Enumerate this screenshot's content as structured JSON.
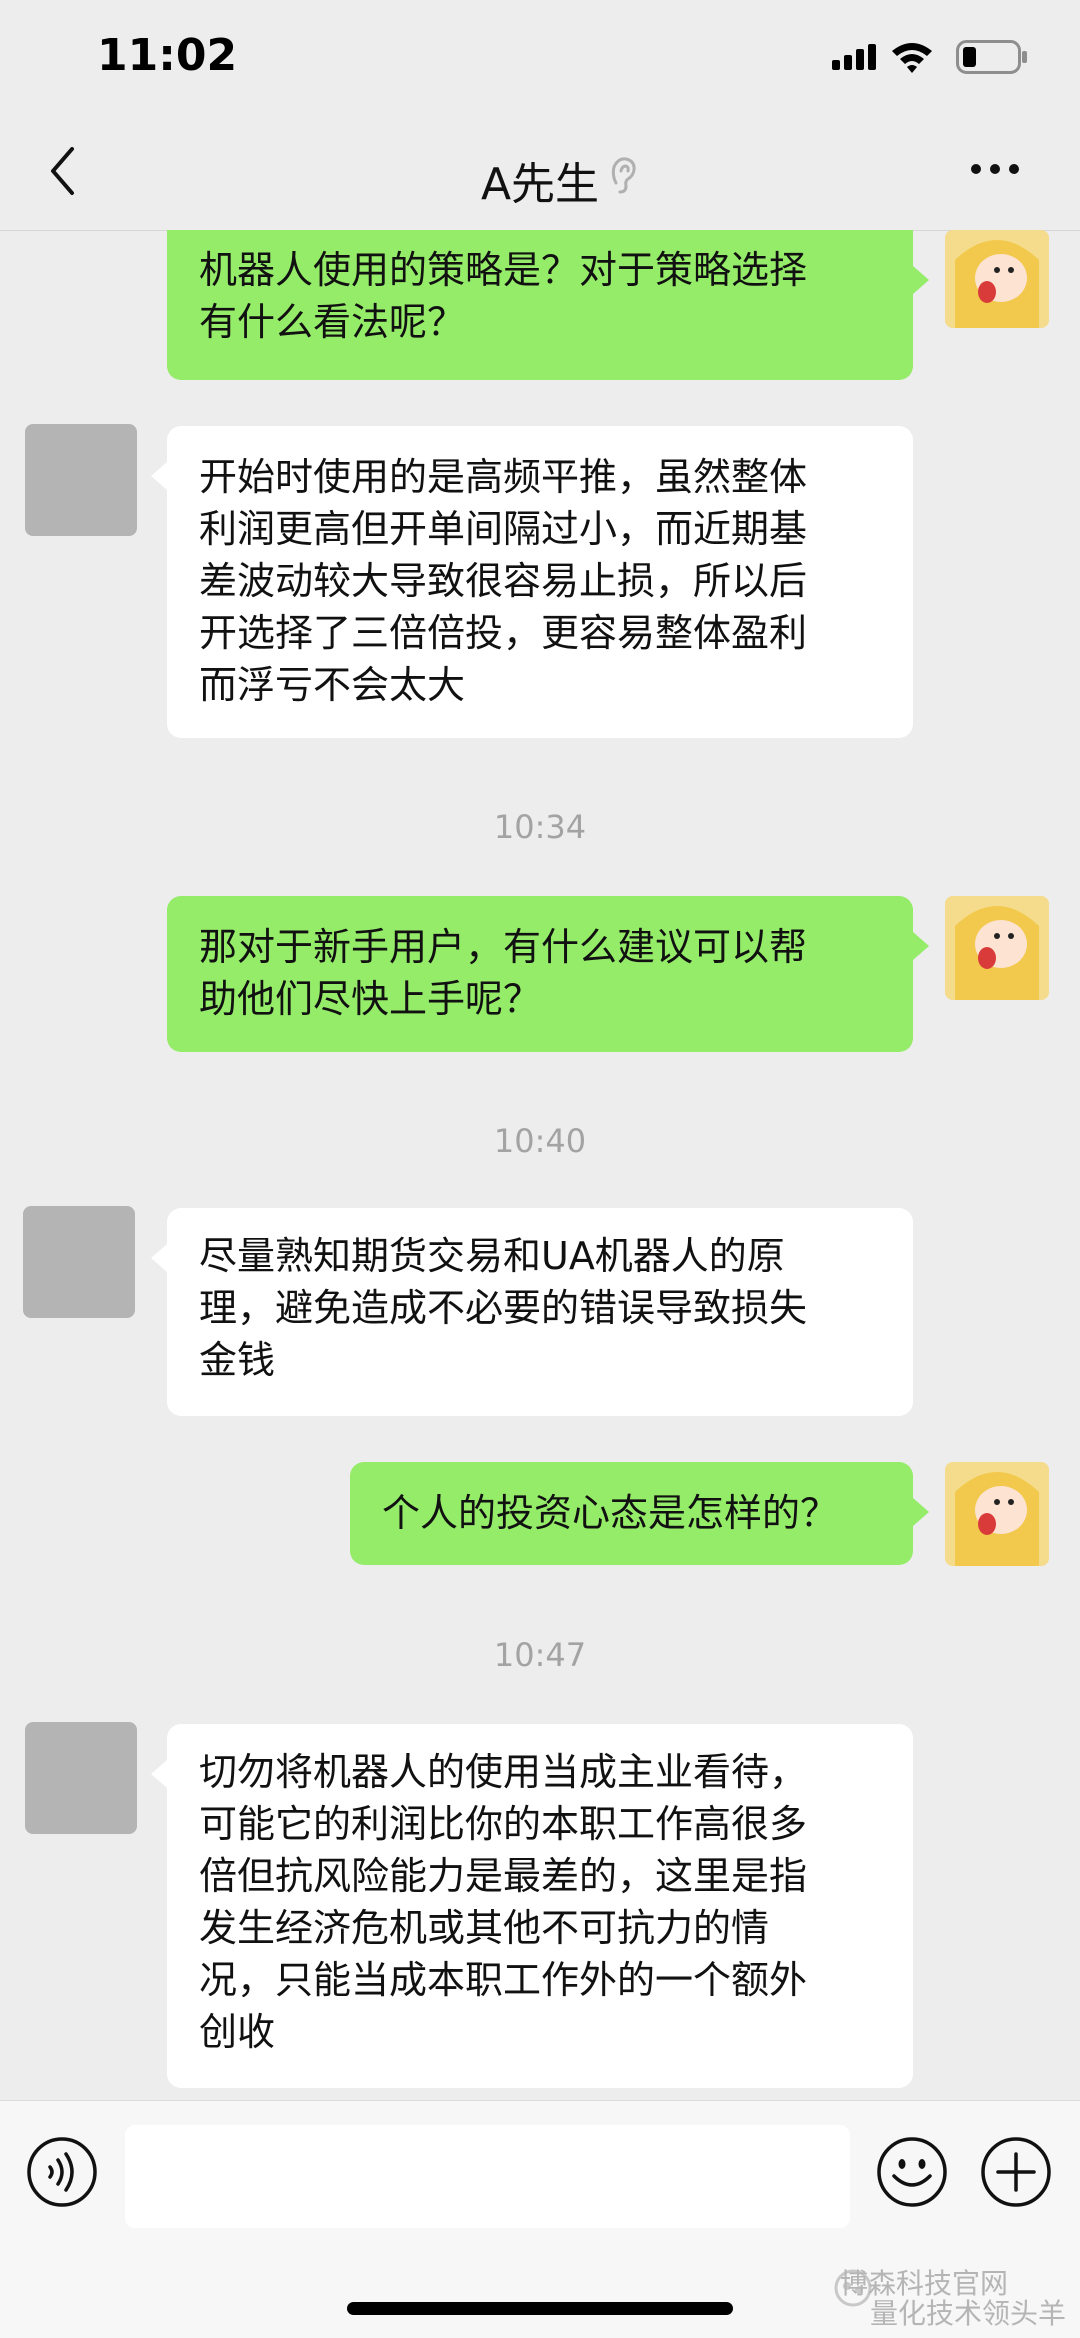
{
  "status_bar": {
    "time": "11:02"
  },
  "nav": {
    "title": "A先生"
  },
  "messages": [
    {
      "sender": "me",
      "text": "机器人使用的策略是？对于策略选择有什么看法呢？",
      "lines": [
        "机器人使用的策略是？对于策略选择",
        "有什么看法呢？"
      ]
    },
    {
      "sender": "other",
      "text": "开始时使用的是高频平推，虽然整体利润更高但开单间隔过小，而近期基差波动较大导致很容易止损，所以后开选择了三倍倍投，更容易整体盈利而浮亏不会太大",
      "lines": [
        "开始时使用的是高频平推，虽然整体",
        "利润更高但开单间隔过小，而近期基",
        "差波动较大导致很容易止损，所以后",
        "开选择了三倍倍投，更容易整体盈利",
        "而浮亏不会太大"
      ]
    },
    {
      "sender": "time",
      "text": "10:34"
    },
    {
      "sender": "me",
      "text": "那对于新手用户，有什么建议可以帮助他们尽快上手呢？",
      "lines": [
        "那对于新手用户，有什么建议可以帮",
        "助他们尽快上手呢？"
      ]
    },
    {
      "sender": "time",
      "text": "10:40"
    },
    {
      "sender": "other",
      "text": "尽量熟知期货交易和UA机器人的原理，避免造成不必要的错误导致损失金钱",
      "lines": [
        "尽量熟知期货交易和UA机器人的原",
        "理，避免造成不必要的错误导致损失",
        "金钱"
      ]
    },
    {
      "sender": "me",
      "text": "个人的投资心态是怎样的？",
      "lines": [
        "个人的投资心态是怎样的？"
      ]
    },
    {
      "sender": "time",
      "text": "10:47"
    },
    {
      "sender": "other",
      "text": "切勿将机器人的使用当成主业看待，可能它的利润比你的本职工作高很多倍但抗风险能力是最差的，这里是指发生经济危机或其他不可抗力的情况，只能当成本职工作外的一个额外创收",
      "lines": [
        "切勿将机器人的使用当成主业看待，",
        "可能它的利润比你的本职工作高很多",
        "倍但抗风险能力是最差的，这里是指",
        "发生经济危机或其他不可抗力的情",
        "况，只能当成本职工作外的一个额外",
        "创收"
      ]
    }
  ],
  "watermark": {
    "line1": "博森科技官网",
    "line2": "量化技术领头羊"
  },
  "icons": {
    "back": "chevron-left-icon",
    "ear": "earpiece-mode-icon",
    "more": "more-icon",
    "voice": "voice-input-icon",
    "emoji": "emoji-icon",
    "plus": "plus-icon"
  },
  "colors": {
    "my_bubble": "#95ec69",
    "their_bubble": "#ffffff",
    "background": "#ededed"
  }
}
